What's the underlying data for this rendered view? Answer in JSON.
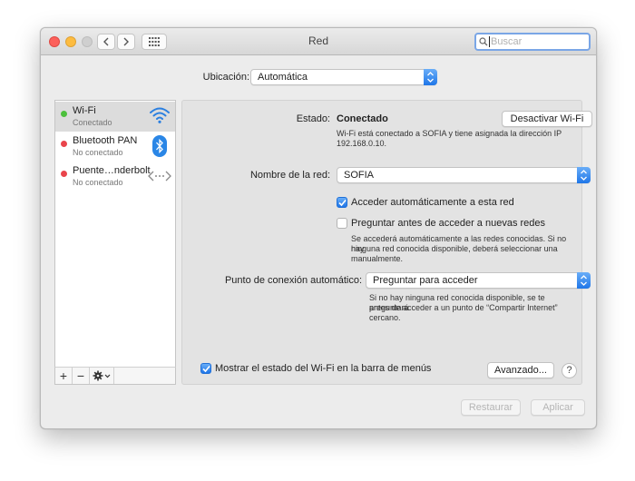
{
  "window": {
    "title": "Red",
    "search_placeholder": "Buscar"
  },
  "location": {
    "label": "Ubicación:",
    "value": "Automática"
  },
  "services": [
    {
      "name": "Wi-Fi",
      "status": "Conectado",
      "status_color": "#4cc03c",
      "icon": "wifi-icon"
    },
    {
      "name": "Bluetooth PAN",
      "status": "No conectado",
      "status_color": "#e9444b",
      "icon": "bluetooth-icon"
    },
    {
      "name": "Puente…nderbolt",
      "status": "No conectado",
      "status_color": "#e9444b",
      "icon": "thunderbolt-bridge-icon"
    }
  ],
  "sidebar_buttons": {
    "add": "+",
    "remove": "−"
  },
  "detail": {
    "status_label": "Estado:",
    "status_value": "Conectado",
    "disable_button": "Desactivar Wi-Fi",
    "status_desc_1": "Wi-Fi está conectado a SOFIA y tiene asignada la dirección IP",
    "status_desc_2": "192.168.0.10.",
    "network_label": "Nombre de la red:",
    "network_value": "SOFIA",
    "auto_join_label": "Acceder automáticamente a esta red",
    "auto_join_checked": true,
    "ask_join_label": "Preguntar antes de acceder a nuevas redes",
    "ask_join_checked": false,
    "ask_desc_1": "Se accederá automáticamente a las redes conocidas. Si no hay",
    "ask_desc_2": "ninguna red conocida disponible, deberá seleccionar una",
    "ask_desc_3": "manualmente.",
    "hotspot_label": "Punto de conexión automático:",
    "hotspot_value": "Preguntar para acceder",
    "hotspot_desc_1": "Si no hay ninguna red conocida disponible, se te preguntará",
    "hotspot_desc_2": "antes de acceder a un punto de “Compartir Internet” cercano.",
    "show_status_label": "Mostrar el estado del Wi-Fi en la barra de menús",
    "show_status_checked": true,
    "advanced_button": "Avanzado...",
    "help_button": "?"
  },
  "footer": {
    "revert_button": "Restaurar",
    "apply_button": "Aplicar"
  },
  "colors": {
    "accent": "#1f76e8",
    "connected": "#4cc03c",
    "disconnected": "#e9444b"
  }
}
